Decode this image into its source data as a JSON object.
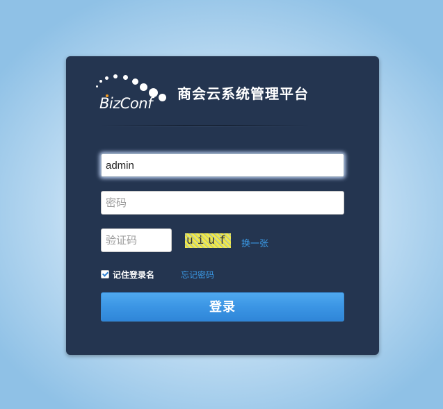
{
  "header": {
    "logo_text": "BizConf",
    "title": "商会云系统管理平台"
  },
  "form": {
    "username_value": "admin",
    "password_placeholder": "密码",
    "captcha_placeholder": "验证码",
    "captcha_text": "uiuf",
    "refresh_captcha_label": "换一张",
    "remember_label": "记住登录名",
    "remember_checked": true,
    "forgot_password_label": "忘记密码",
    "login_label": "登录"
  },
  "colors": {
    "panel": "#243550",
    "accent": "#3b95e4",
    "link": "#3b9be8"
  }
}
